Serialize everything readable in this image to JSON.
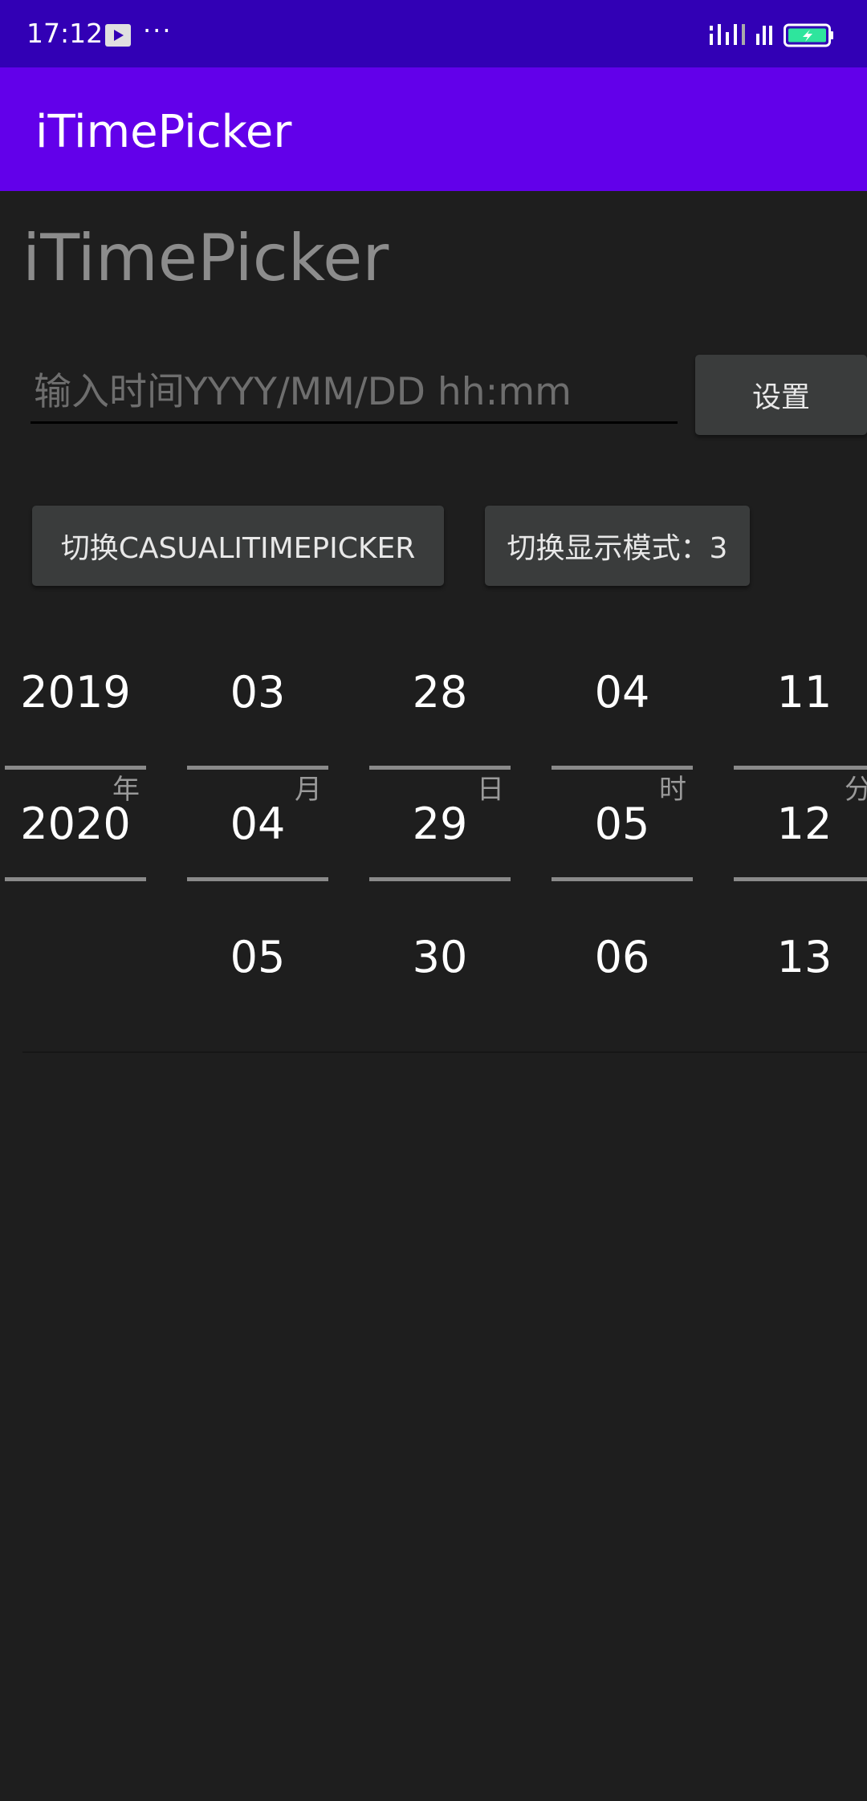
{
  "status_bar": {
    "time": "17:12",
    "more": "···",
    "icons": [
      "video-icon",
      "signal-icon",
      "signal-2-icon",
      "battery-charging-icon"
    ],
    "battery_color": "#2ee59d"
  },
  "app_bar": {
    "title": "iTimePicker",
    "color": "#6200ea"
  },
  "content": {
    "title": "iTimePicker",
    "input_placeholder": "输入时间YYYY/MM/DD hh:mm",
    "input_value": "",
    "set_button": "设置",
    "switch_button": "切换CASUALITIMEPICKER",
    "mode_button": "切换显示模式：3"
  },
  "picker": {
    "columns": [
      {
        "unit": "年",
        "items": [
          "2019",
          "2020",
          ""
        ]
      },
      {
        "unit": "月",
        "items": [
          "03",
          "04",
          "05"
        ]
      },
      {
        "unit": "日",
        "items": [
          "28",
          "29",
          "30"
        ]
      },
      {
        "unit": "时",
        "items": [
          "04",
          "05",
          "06"
        ]
      },
      {
        "unit": "分",
        "items": [
          "11",
          "12",
          "13"
        ]
      }
    ]
  }
}
